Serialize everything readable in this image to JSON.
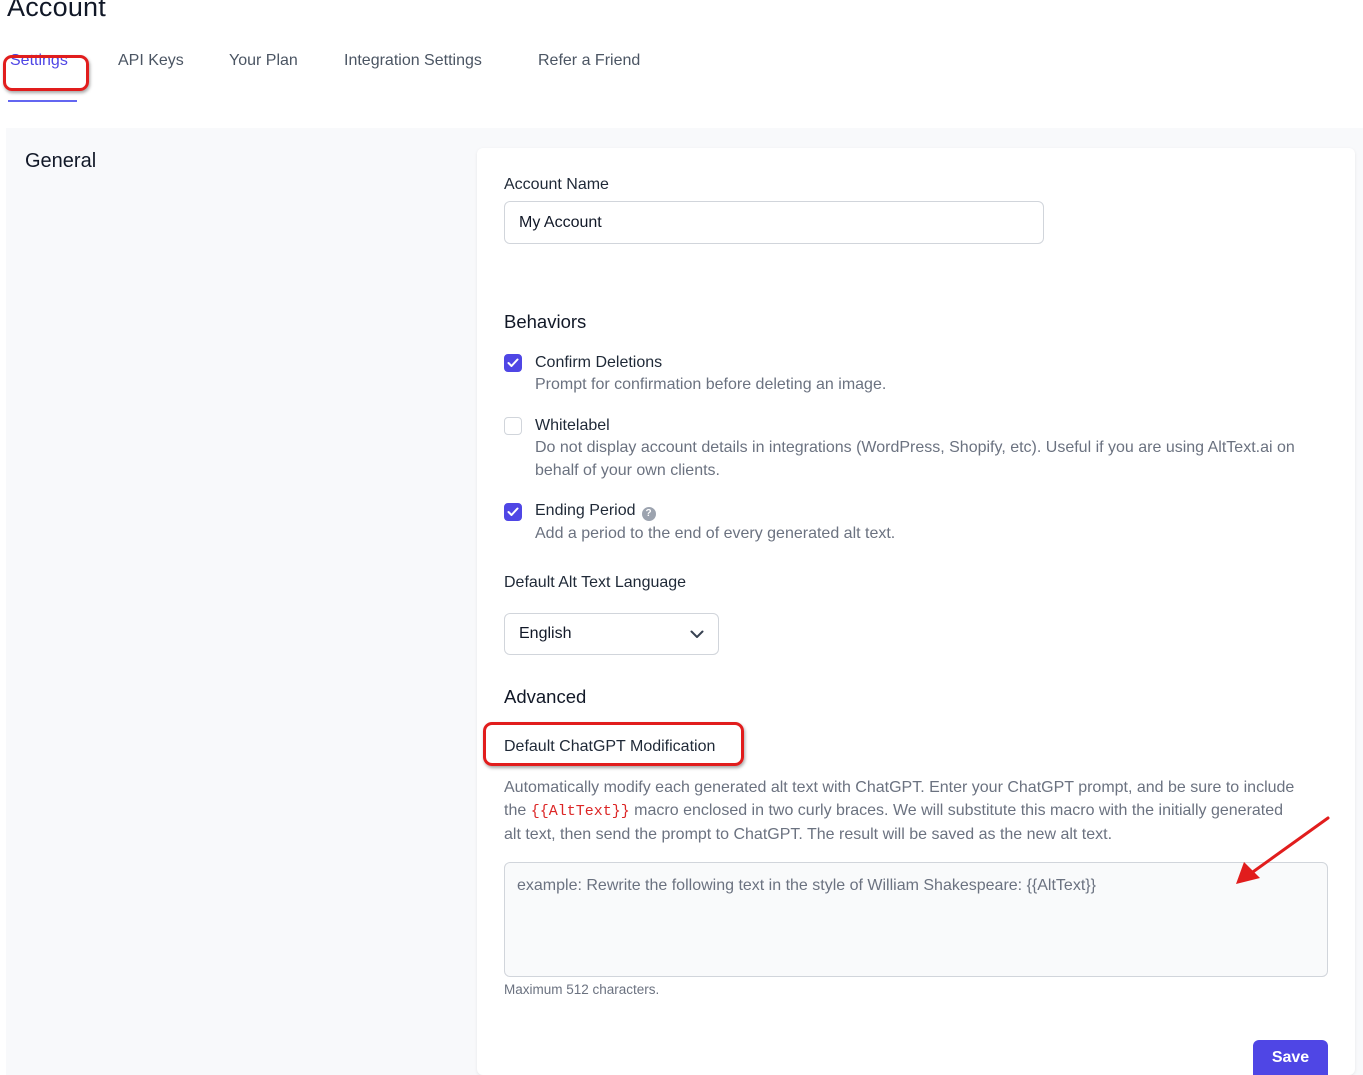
{
  "page": {
    "title": "Account"
  },
  "tabs": [
    {
      "label": "Settings",
      "active": true
    },
    {
      "label": "API Keys"
    },
    {
      "label": "Your Plan"
    },
    {
      "label": "Integration Settings"
    },
    {
      "label": "Refer a Friend"
    }
  ],
  "section": {
    "title": "General"
  },
  "account_name": {
    "label": "Account Name",
    "value": "My Account"
  },
  "behaviors": {
    "heading": "Behaviors",
    "items": [
      {
        "label": "Confirm Deletions",
        "description": "Prompt for confirmation before deleting an image.",
        "checked": true
      },
      {
        "label": "Whitelabel",
        "description": "Do not display account details in integrations (WordPress, Shopify, etc). Useful if you are using AltText.ai on behalf of your own clients.",
        "checked": false
      },
      {
        "label": "Ending Period",
        "description": "Add a period to the end of every generated alt text.",
        "checked": true,
        "help_icon": "question-circle-icon"
      }
    ]
  },
  "language": {
    "label": "Default Alt Text Language",
    "selected": "English"
  },
  "advanced": {
    "heading": "Advanced",
    "chatgpt_label": "Default ChatGPT Modification",
    "desc_part1": "Automatically modify each generated alt text with ChatGPT. Enter your ChatGPT prompt, and be sure to include the ",
    "macro": "{{AltText}}",
    "desc_part2": " macro enclosed in two curly braces. We will substitute this macro with the initially generated alt text, then send the prompt to ChatGPT. The result will be saved as the new alt text.",
    "placeholder": "example: Rewrite the following text in the style of William Shakespeare: {{AltText}}",
    "hint": "Maximum 512 characters."
  },
  "actions": {
    "save_label": "Save"
  },
  "colors": {
    "accent": "#4f46e5",
    "annotation": "#e11d1d"
  }
}
